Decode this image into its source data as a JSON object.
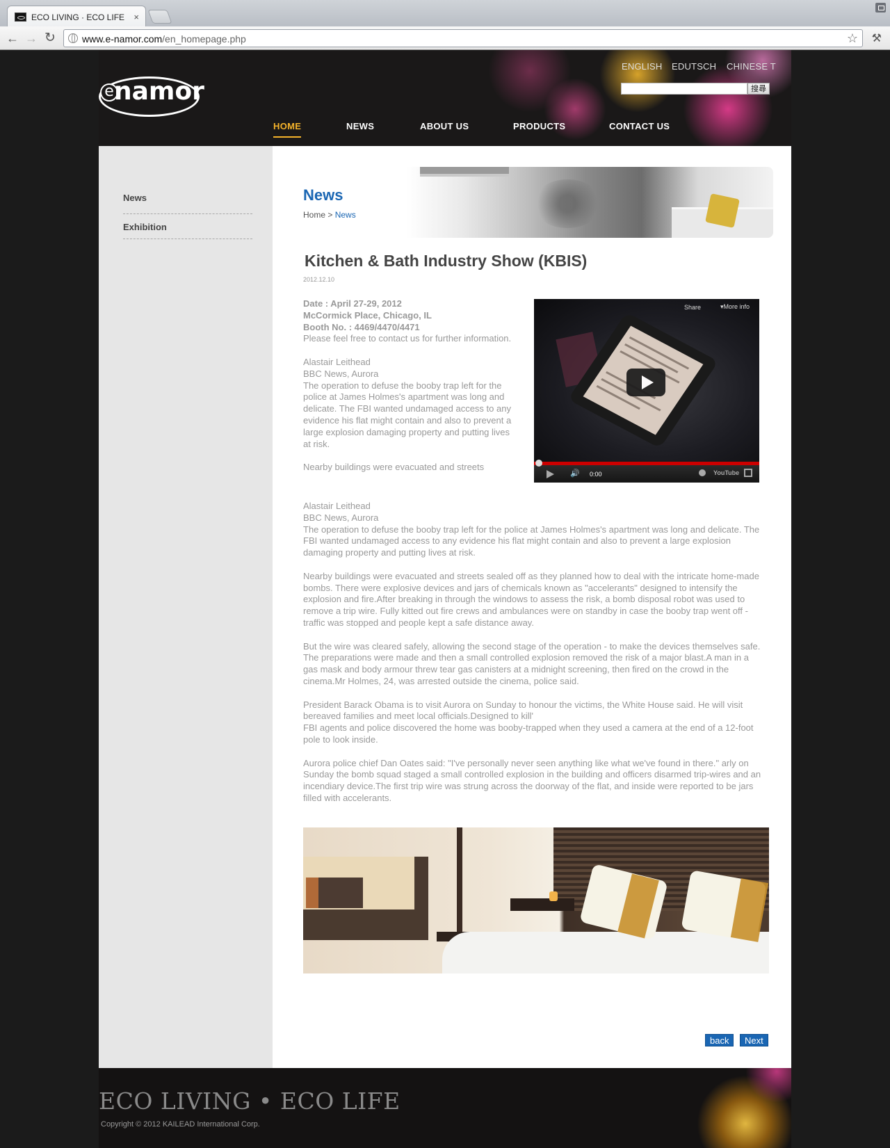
{
  "browser": {
    "tab_title": "ECO LIVING · ECO LIFE",
    "tab_close": "×",
    "url_host": "www.e-namor.com",
    "url_path": "/en_homepage.php",
    "back_glyph": "←",
    "forward_glyph": "→",
    "reload_glyph": "↻",
    "star_glyph": "☆",
    "wrench_glyph": "🔧"
  },
  "header": {
    "logo_e": "e",
    "logo_text": "namor",
    "languages": [
      "ENGLISH",
      "EDUTSCH",
      "CHINESE T"
    ],
    "search_button": "搜尋",
    "nav": [
      "HOME",
      "NEWS",
      "ABOUT US",
      "PRODUCTS",
      "CONTACT US"
    ],
    "nav_active": "HOME",
    "accent": "#f5b32b"
  },
  "sidebar": {
    "items": [
      "News",
      "Exhibition"
    ]
  },
  "page": {
    "title": "News",
    "breadcrumb_home": "Home",
    "breadcrumb_sep": ">",
    "breadcrumb_current": "News",
    "accent": "#1a66b3"
  },
  "article": {
    "title": "Kitchen & Bath Industry Show (KBIS)",
    "date": "2012.12.10",
    "info_date": "Date : April 27-29, 2012",
    "info_place": "McCormick Place, Chicago, IL",
    "info_booth": "Booth No. : 4469/4470/4471",
    "info_contact": "Please feel free to contact us for further information.",
    "side_author": "Alastair Leithead",
    "side_org": "BBC News, Aurora",
    "side_p1": "The operation to defuse the booby trap left for the police at James Holmes's apartment was long and delicate. The FBI wanted undamaged access to any evidence his flat might contain and also to prevent a large explosion damaging property and putting lives at risk.",
    "side_p2": "Nearby buildings were evacuated and streets",
    "author": "Alastair Leithead",
    "org": "BBC News, Aurora",
    "p1": "The operation to defuse the booby trap left for the police at James Holmes's apartment was long and delicate. The FBI wanted undamaged access to any evidence his flat might contain and also to prevent a large explosion damaging property and putting lives at risk.",
    "p2": "Nearby buildings were evacuated and streets sealed off as they planned how to deal with the intricate home-made bombs. There were explosive devices and jars of chemicals known as \"accelerants\" designed to intensify the explosion and fire.After breaking in through the windows to assess the risk, a bomb disposal robot was used to remove a trip wire. Fully kitted out fire crews and ambulances were on standby in case the booby trap went off - traffic was stopped and people kept a safe distance away.",
    "p3": "But the wire was cleared safely, allowing the second stage of the operation - to make the devices themselves safe. The preparations were made and then a small controlled explosion removed the risk of a major blast.A man in a gas mask and body armour threw tear gas canisters at a midnight screening, then fired on the crowd in the cinema.Mr Holmes, 24, was arrested outside the cinema, police said.",
    "p4a": "President Barack Obama is to visit Aurora on Sunday to honour the victims, the White House said. He will visit bereaved families and meet local officials.Designed to kill'",
    "p4b": "FBI agents and police discovered the home was booby-trapped when they used a camera at the end of a 12-foot pole to look inside.",
    "p5": "Aurora police chief Dan Oates said: \"I've personally never seen anything like what we've found in there.\" arly on Sunday the bomb squad staged a small controlled explosion in the building and officers disarmed trip-wires and an incendiary device.The first trip wire was strung across the doorway of the flat, and inside were reported to be jars filled with accelerants."
  },
  "video": {
    "share": "Share",
    "more_info": "More info",
    "time": "0:00",
    "brand": "YouTube",
    "progress": 0
  },
  "pager": {
    "back": "back",
    "next": "Next"
  },
  "footer": {
    "slogan": "ECO LIVING • ECO LIFE",
    "copyright": "Copyright ©  2012 KAILEAD International Corp."
  }
}
